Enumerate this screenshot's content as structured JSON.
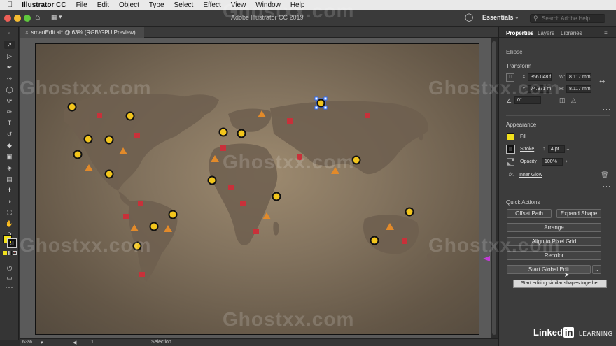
{
  "menubar": {
    "apple": "",
    "app": "Illustrator CC",
    "items": [
      "File",
      "Edit",
      "Object",
      "Type",
      "Select",
      "Effect",
      "View",
      "Window",
      "Help"
    ]
  },
  "appbar": {
    "title": "Adobe Illustrator CC 2019",
    "workspace": "Essentials",
    "search_placeholder": "Search Adobe Help"
  },
  "document": {
    "tab_title": "smartEdit.ai* @ 63% (RGB/GPU Preview)",
    "close": "×"
  },
  "panel": {
    "tabs": [
      "Properties",
      "Layers",
      "Libraries"
    ],
    "object_type": "Ellipse",
    "transform": {
      "heading": "Transform",
      "x_label": "X:",
      "x": "356.048 f",
      "y_label": "Y:",
      "y": "74.971 m",
      "w_label": "W:",
      "w": "8.117 mm",
      "h_label": "H:",
      "h": "8.117 mm",
      "rotate": "0°"
    },
    "appearance": {
      "heading": "Appearance",
      "fill_label": "Fill",
      "fill_color": "#f2e11c",
      "stroke_label": "Stroke",
      "stroke_weight": "4 pt",
      "opacity_label": "Opacity",
      "opacity": "100%",
      "effect_prefix": "fx.",
      "effect": "Inner Glow"
    },
    "quick_actions": {
      "heading": "Quick Actions",
      "offset_path": "Offset Path",
      "expand_shape": "Expand Shape",
      "arrange": "Arrange",
      "align_pixel": "Align to Pixel Grid",
      "recolor": "Recolor",
      "start_global_edit": "Start Global Edit"
    },
    "tooltip": "Start editing similar shapes together"
  },
  "status": {
    "zoom": "63%",
    "artboard_num": "1",
    "tool": "Selection"
  },
  "watermark": "Ghostxx.com",
  "branding": {
    "linked": "Linked",
    "in": "in",
    "learning": "LEARNING"
  }
}
